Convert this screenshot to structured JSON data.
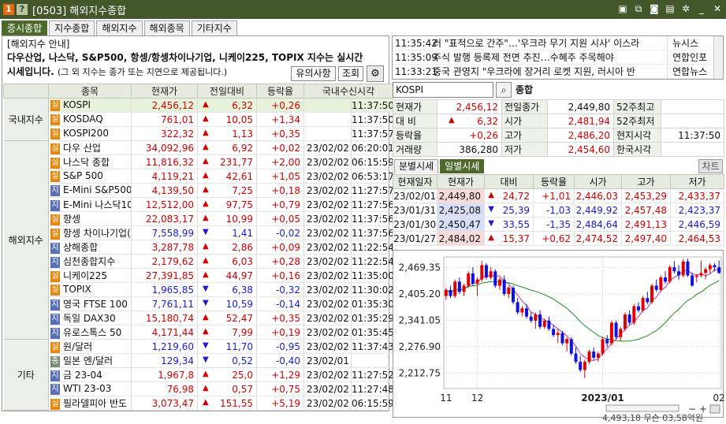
{
  "window": {
    "badge1": "1",
    "badge2": "?",
    "title": "[0503] 해외지수종합",
    "icons": [
      "layout-icon",
      "link-icon",
      "camera-icon",
      "print-icon",
      "gear-icon",
      "minimize-icon",
      "close-icon"
    ]
  },
  "tabs": [
    {
      "label": "증시종합",
      "active": true
    },
    {
      "label": "지수종합",
      "active": false
    },
    {
      "label": "해외지수",
      "active": false
    },
    {
      "label": "해외종목",
      "active": false
    },
    {
      "label": "기타지수",
      "active": false
    }
  ],
  "notice": {
    "heading": "[해외지수 안내]",
    "line1": "다우산업, 나스닥, S&P500, 항셍/항셍차이나기업, 니케이225, TOPIX 지수는 실시간",
    "line2": "시세입니다.",
    "line2_sub": "(그 외 지수는 종가 또는 지연으로 제공됩니다.)"
  },
  "buttons": {
    "caution": "유의사항",
    "query": "조회",
    "settings": "⚙"
  },
  "table": {
    "headers": [
      "종목",
      "현재가",
      "전일대비",
      "등락율",
      "국내수신시각"
    ],
    "groups": [
      {
        "name": "국내지수",
        "rows": [
          {
            "type": "실",
            "name": "KOSPI",
            "price": "2,456,12",
            "dir": "up",
            "change": "6,32",
            "rate": "+0,26",
            "date": "",
            "time": "11:37:50",
            "highlight": true
          },
          {
            "type": "실",
            "name": "KOSDAQ",
            "price": "761,01",
            "dir": "up",
            "change": "10,05",
            "rate": "+1,34",
            "date": "",
            "time": "11:37:50"
          },
          {
            "type": "실",
            "name": "KOSPI200",
            "price": "322,32",
            "dir": "up",
            "change": "1,13",
            "rate": "+0,35",
            "date": "",
            "time": "11:37:57"
          }
        ]
      },
      {
        "name": "해외지수",
        "rows": [
          {
            "type": "실",
            "name": "다우 산업",
            "price": "34,092,96",
            "dir": "up",
            "change": "6,92",
            "rate": "+0,02",
            "date": "23/02/02",
            "time": "06:20:01"
          },
          {
            "type": "실",
            "name": "나스닥 종합",
            "price": "11,816,32",
            "dir": "up",
            "change": "231,77",
            "rate": "+2,00",
            "date": "23/02/02",
            "time": "06:15:59"
          },
          {
            "type": "실",
            "name": "S&P 500",
            "price": "4,119,21",
            "dir": "up",
            "change": "42,61",
            "rate": "+1,05",
            "date": "23/02/02",
            "time": "06:53:17"
          },
          {
            "type": "지",
            "name": "E-Mini S&P500",
            "price": "4,139,50",
            "dir": "up",
            "change": "7,25",
            "rate": "+0,18",
            "date": "23/02/02",
            "time": "11:27:57"
          },
          {
            "type": "지",
            "name": "E-Mini 나스닥100",
            "price": "12,512,00",
            "dir": "up",
            "change": "97,75",
            "rate": "+0,79",
            "date": "23/02/02",
            "time": "11:27:56"
          },
          {
            "type": "실",
            "name": "항셍",
            "price": "22,083,17",
            "dir": "up",
            "change": "10,99",
            "rate": "+0,05",
            "date": "23/02/02",
            "time": "11:37:56"
          },
          {
            "type": "실",
            "name": "항셍 차이나기업(",
            "price": "7,558,99",
            "dir": "down",
            "change": "1,41",
            "rate": "-0,02",
            "date": "23/02/02",
            "time": "11:37:56"
          },
          {
            "type": "지",
            "name": "상해종합",
            "price": "3,287,78",
            "dir": "up",
            "change": "2,86",
            "rate": "+0,09",
            "date": "23/02/02",
            "time": "11:22:54"
          },
          {
            "type": "지",
            "name": "심천종합지수",
            "price": "2,179,62",
            "dir": "up",
            "change": "6,03",
            "rate": "+0,28",
            "date": "23/02/02",
            "time": "11:22:54"
          },
          {
            "type": "실",
            "name": "니케이225",
            "price": "27,391,85",
            "dir": "up",
            "change": "44,97",
            "rate": "+0,16",
            "date": "23/02/02",
            "time": "11:35:00"
          },
          {
            "type": "실",
            "name": "TOPIX",
            "price": "1,965,85",
            "dir": "down",
            "change": "6,38",
            "rate": "-0,32",
            "date": "23/02/02",
            "time": "11:30:02"
          },
          {
            "type": "지",
            "name": "영국 FTSE 100",
            "price": "7,761,11",
            "dir": "down",
            "change": "10,59",
            "rate": "-0,14",
            "date": "23/02/02",
            "time": "01:35:30"
          },
          {
            "type": "지",
            "name": "독일 DAX30",
            "price": "15,180,74",
            "dir": "up",
            "change": "52,47",
            "rate": "+0,35",
            "date": "23/02/02",
            "time": "01:35:29"
          },
          {
            "type": "지",
            "name": "유로스톡스 50",
            "price": "4,171,44",
            "dir": "up",
            "change": "7,99",
            "rate": "+0,19",
            "date": "23/02/02",
            "time": "01:35:45"
          }
        ]
      },
      {
        "name": "기타",
        "rows": [
          {
            "type": "실",
            "name": "원/달러",
            "price": "1,219,60",
            "dir": "down",
            "change": "11,70",
            "rate": "-0,95",
            "date": "23/02/02",
            "time": "11:37:43"
          },
          {
            "type": "종",
            "name": "일본 엔/달러",
            "price": "129,34",
            "dir": "down",
            "change": "0,52",
            "rate": "-0,40",
            "date": "23/02/01",
            "time": ""
          },
          {
            "type": "지",
            "name": "금 23-04",
            "price": "1,967,8",
            "dir": "up",
            "change": "25,0",
            "rate": "+1,29",
            "date": "23/02/02",
            "time": "11:27:52"
          },
          {
            "type": "지",
            "name": "WTI 23-03",
            "price": "76,98",
            "dir": "up",
            "change": "0,57",
            "rate": "+0,75",
            "date": "23/02/02",
            "time": "11:27:48"
          },
          {
            "type": "실",
            "name": "필라델피아 반도",
            "price": "3,073,47",
            "dir": "up",
            "change": "151,55",
            "rate": "+5,19",
            "date": "23/02/02",
            "time": "06:15:59"
          }
        ]
      }
    ]
  },
  "news": [
    {
      "time": "11:35:42",
      "text": "러 \"표적으로 간주\"…'우크라 무기 지원 시사' 이스라",
      "source": "뉴시스"
    },
    {
      "time": "11:35:09",
      "text": "주식 발행 등록제 전면 추진…수혜주 주목해야",
      "source": "연합인포"
    },
    {
      "time": "11:33:21",
      "text": "중국 관영지 \"우크라에 장거리 로켓 지원, 러시아 반",
      "source": "연합뉴스"
    }
  ],
  "code": {
    "value": "KOSPI",
    "search_icon": "magnifier-icon",
    "name": "종합"
  },
  "quote": {
    "rows": [
      [
        {
          "l": "현재가"
        },
        {
          "v": "2,456,12",
          "c": "up"
        },
        {
          "l": "전일종가"
        },
        {
          "v": "2,449,80"
        },
        {
          "l": "52주최고"
        },
        {
          "v": ""
        }
      ],
      [
        {
          "l": "대  비"
        },
        {
          "v": "6,32",
          "c": "up",
          "tri": "up"
        },
        {
          "l": "시가"
        },
        {
          "v": "2,481,94",
          "c": "up"
        },
        {
          "l": "52주최저"
        },
        {
          "v": ""
        }
      ],
      [
        {
          "l": "등락율"
        },
        {
          "v": "+0,26",
          "c": "up"
        },
        {
          "l": "고가"
        },
        {
          "v": "2,486,20",
          "c": "up"
        },
        {
          "l": "현지시각"
        },
        {
          "v": "11:37:50"
        }
      ],
      [
        {
          "l": "거래량"
        },
        {
          "v": "386,280"
        },
        {
          "l": "저가"
        },
        {
          "v": "2,454,60",
          "c": "up"
        },
        {
          "l": "한국시각"
        },
        {
          "v": ""
        }
      ]
    ]
  },
  "subtabs": [
    {
      "label": "분별시세",
      "active": false
    },
    {
      "label": "일별시세",
      "active": true
    }
  ],
  "chart_button": "차트",
  "daily": {
    "headers": [
      "현재일자",
      "현재가",
      "대비",
      "등락율",
      "시가",
      "고가",
      "저가"
    ],
    "rows": [
      {
        "date": "23/02/01",
        "price": "2,449,80",
        "dir": "up",
        "change": "24,72",
        "rate": "+1,01",
        "open": "2,446,03",
        "high": "2,453,29",
        "low": "2,433,37",
        "bg": "red"
      },
      {
        "date": "23/01/31",
        "price": "2,425,08",
        "dir": "down",
        "change": "25,39",
        "rate": "-1,03",
        "open": "2,449,92",
        "high": "2,457,48",
        "low": "2,423,37",
        "bg": "blue"
      },
      {
        "date": "23/01/30",
        "price": "2,450,47",
        "dir": "down",
        "change": "33,55",
        "rate": "-1,35",
        "open": "2,484,64",
        "high": "2,491,13",
        "low": "2,446,59",
        "bg": "blue"
      },
      {
        "date": "23/01/27",
        "price": "2,484,02",
        "dir": "up",
        "change": "15,37",
        "rate": "+0,62",
        "open": "2,474,52",
        "high": "2,497,40",
        "low": "2,464,53",
        "bg": "red"
      }
    ]
  },
  "chart_data": {
    "type": "candlestick",
    "y_ticks": [
      "2,469.35",
      "2,405.20",
      "2,341.05",
      "2,276.90",
      "2,212.75"
    ],
    "y_tick_values": [
      2469.35,
      2405.2,
      2341.05,
      2276.9,
      2212.75
    ],
    "ylim": [
      2175,
      2495
    ],
    "x_labels": [
      "11",
      "12",
      "2023/01",
      "02"
    ],
    "x_label_indices": [
      0,
      7,
      35,
      61
    ],
    "candles": [
      [
        2400,
        2420,
        2390,
        2415
      ],
      [
        2415,
        2425,
        2395,
        2400
      ],
      [
        2400,
        2440,
        2395,
        2435
      ],
      [
        2435,
        2445,
        2405,
        2410
      ],
      [
        2410,
        2430,
        2400,
        2425
      ],
      [
        2425,
        2460,
        2420,
        2455
      ],
      [
        2455,
        2470,
        2425,
        2430
      ],
      [
        2430,
        2445,
        2400,
        2440
      ],
      [
        2440,
        2485,
        2435,
        2475
      ],
      [
        2475,
        2480,
        2440,
        2445
      ],
      [
        2445,
        2470,
        2440,
        2460
      ],
      [
        2460,
        2465,
        2420,
        2425
      ],
      [
        2425,
        2445,
        2415,
        2440
      ],
      [
        2440,
        2450,
        2400,
        2405
      ],
      [
        2405,
        2425,
        2395,
        2420
      ],
      [
        2420,
        2425,
        2380,
        2385
      ],
      [
        2385,
        2395,
        2355,
        2360
      ],
      [
        2360,
        2375,
        2350,
        2370
      ],
      [
        2370,
        2380,
        2345,
        2350
      ],
      [
        2350,
        2360,
        2335,
        2340
      ],
      [
        2340,
        2360,
        2320,
        2355
      ],
      [
        2355,
        2365,
        2320,
        2325
      ],
      [
        2325,
        2345,
        2320,
        2340
      ],
      [
        2340,
        2350,
        2315,
        2320
      ],
      [
        2320,
        2330,
        2300,
        2305
      ],
      [
        2305,
        2320,
        2285,
        2310
      ],
      [
        2310,
        2315,
        2280,
        2285
      ],
      [
        2285,
        2300,
        2265,
        2295
      ],
      [
        2295,
        2300,
        2255,
        2260
      ],
      [
        2260,
        2275,
        2235,
        2240
      ],
      [
        2240,
        2255,
        2215,
        2220
      ],
      [
        2220,
        2245,
        2200,
        2240
      ],
      [
        2240,
        2270,
        2235,
        2265
      ],
      [
        2265,
        2275,
        2245,
        2250
      ],
      [
        2250,
        2265,
        2240,
        2260
      ],
      [
        2260,
        2300,
        2255,
        2295
      ],
      [
        2295,
        2305,
        2275,
        2285
      ],
      [
        2285,
        2340,
        2280,
        2335
      ],
      [
        2335,
        2340,
        2295,
        2300
      ],
      [
        2300,
        2325,
        2290,
        2320
      ],
      [
        2320,
        2360,
        2315,
        2355
      ],
      [
        2355,
        2365,
        2330,
        2335
      ],
      [
        2335,
        2380,
        2330,
        2375
      ],
      [
        2375,
        2385,
        2360,
        2365
      ],
      [
        2365,
        2400,
        2360,
        2395
      ],
      [
        2395,
        2410,
        2380,
        2385
      ],
      [
        2385,
        2430,
        2380,
        2425
      ],
      [
        2425,
        2440,
        2410,
        2415
      ],
      [
        2415,
        2450,
        2410,
        2445
      ],
      [
        2445,
        2460,
        2430,
        2435
      ],
      [
        2435,
        2475,
        2430,
        2470
      ],
      [
        2470,
        2485,
        2455,
        2460
      ],
      [
        2460,
        2475,
        2440,
        2450
      ],
      [
        2450,
        2490,
        2445,
        2484
      ],
      [
        2484,
        2491,
        2446,
        2450
      ],
      [
        2450,
        2457,
        2423,
        2425
      ],
      [
        2446,
        2453,
        2433,
        2450
      ],
      [
        2450,
        2486,
        2445,
        2456
      ],
      [
        2456,
        2470,
        2440,
        2465
      ],
      [
        2465,
        2480,
        2455,
        2475
      ],
      [
        2475,
        2480,
        2460,
        2470
      ],
      [
        2470,
        2486,
        2454,
        2456
      ]
    ],
    "ma_short_color": "#b03bb0",
    "ma_long_color": "#1a8f1a",
    "up_color": "#e00000",
    "down_color": "#1010e0"
  },
  "status": {
    "text": "4,493,18 무슨 03,58억원"
  }
}
